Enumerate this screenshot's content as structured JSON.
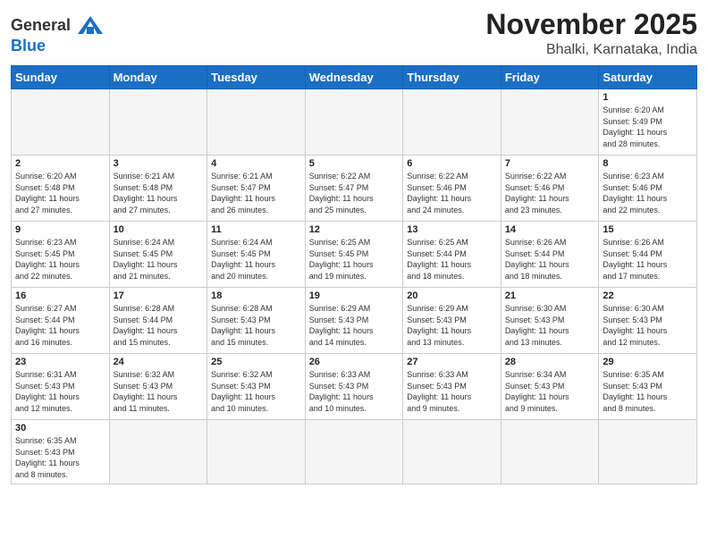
{
  "header": {
    "logo_general": "General",
    "logo_blue": "Blue",
    "month_title": "November 2025",
    "location": "Bhalki, Karnataka, India"
  },
  "weekdays": [
    "Sunday",
    "Monday",
    "Tuesday",
    "Wednesday",
    "Thursday",
    "Friday",
    "Saturday"
  ],
  "weeks": [
    [
      {
        "day": "",
        "info": ""
      },
      {
        "day": "",
        "info": ""
      },
      {
        "day": "",
        "info": ""
      },
      {
        "day": "",
        "info": ""
      },
      {
        "day": "",
        "info": ""
      },
      {
        "day": "",
        "info": ""
      },
      {
        "day": "1",
        "info": "Sunrise: 6:20 AM\nSunset: 5:49 PM\nDaylight: 11 hours\nand 28 minutes."
      }
    ],
    [
      {
        "day": "2",
        "info": "Sunrise: 6:20 AM\nSunset: 5:48 PM\nDaylight: 11 hours\nand 27 minutes."
      },
      {
        "day": "3",
        "info": "Sunrise: 6:21 AM\nSunset: 5:48 PM\nDaylight: 11 hours\nand 27 minutes."
      },
      {
        "day": "4",
        "info": "Sunrise: 6:21 AM\nSunset: 5:47 PM\nDaylight: 11 hours\nand 26 minutes."
      },
      {
        "day": "5",
        "info": "Sunrise: 6:22 AM\nSunset: 5:47 PM\nDaylight: 11 hours\nand 25 minutes."
      },
      {
        "day": "6",
        "info": "Sunrise: 6:22 AM\nSunset: 5:46 PM\nDaylight: 11 hours\nand 24 minutes."
      },
      {
        "day": "7",
        "info": "Sunrise: 6:22 AM\nSunset: 5:46 PM\nDaylight: 11 hours\nand 23 minutes."
      },
      {
        "day": "8",
        "info": "Sunrise: 6:23 AM\nSunset: 5:46 PM\nDaylight: 11 hours\nand 22 minutes."
      }
    ],
    [
      {
        "day": "9",
        "info": "Sunrise: 6:23 AM\nSunset: 5:45 PM\nDaylight: 11 hours\nand 22 minutes."
      },
      {
        "day": "10",
        "info": "Sunrise: 6:24 AM\nSunset: 5:45 PM\nDaylight: 11 hours\nand 21 minutes."
      },
      {
        "day": "11",
        "info": "Sunrise: 6:24 AM\nSunset: 5:45 PM\nDaylight: 11 hours\nand 20 minutes."
      },
      {
        "day": "12",
        "info": "Sunrise: 6:25 AM\nSunset: 5:45 PM\nDaylight: 11 hours\nand 19 minutes."
      },
      {
        "day": "13",
        "info": "Sunrise: 6:25 AM\nSunset: 5:44 PM\nDaylight: 11 hours\nand 18 minutes."
      },
      {
        "day": "14",
        "info": "Sunrise: 6:26 AM\nSunset: 5:44 PM\nDaylight: 11 hours\nand 18 minutes."
      },
      {
        "day": "15",
        "info": "Sunrise: 6:26 AM\nSunset: 5:44 PM\nDaylight: 11 hours\nand 17 minutes."
      }
    ],
    [
      {
        "day": "16",
        "info": "Sunrise: 6:27 AM\nSunset: 5:44 PM\nDaylight: 11 hours\nand 16 minutes."
      },
      {
        "day": "17",
        "info": "Sunrise: 6:28 AM\nSunset: 5:44 PM\nDaylight: 11 hours\nand 15 minutes."
      },
      {
        "day": "18",
        "info": "Sunrise: 6:28 AM\nSunset: 5:43 PM\nDaylight: 11 hours\nand 15 minutes."
      },
      {
        "day": "19",
        "info": "Sunrise: 6:29 AM\nSunset: 5:43 PM\nDaylight: 11 hours\nand 14 minutes."
      },
      {
        "day": "20",
        "info": "Sunrise: 6:29 AM\nSunset: 5:43 PM\nDaylight: 11 hours\nand 13 minutes."
      },
      {
        "day": "21",
        "info": "Sunrise: 6:30 AM\nSunset: 5:43 PM\nDaylight: 11 hours\nand 13 minutes."
      },
      {
        "day": "22",
        "info": "Sunrise: 6:30 AM\nSunset: 5:43 PM\nDaylight: 11 hours\nand 12 minutes."
      }
    ],
    [
      {
        "day": "23",
        "info": "Sunrise: 6:31 AM\nSunset: 5:43 PM\nDaylight: 11 hours\nand 12 minutes."
      },
      {
        "day": "24",
        "info": "Sunrise: 6:32 AM\nSunset: 5:43 PM\nDaylight: 11 hours\nand 11 minutes."
      },
      {
        "day": "25",
        "info": "Sunrise: 6:32 AM\nSunset: 5:43 PM\nDaylight: 11 hours\nand 10 minutes."
      },
      {
        "day": "26",
        "info": "Sunrise: 6:33 AM\nSunset: 5:43 PM\nDaylight: 11 hours\nand 10 minutes."
      },
      {
        "day": "27",
        "info": "Sunrise: 6:33 AM\nSunset: 5:43 PM\nDaylight: 11 hours\nand 9 minutes."
      },
      {
        "day": "28",
        "info": "Sunrise: 6:34 AM\nSunset: 5:43 PM\nDaylight: 11 hours\nand 9 minutes."
      },
      {
        "day": "29",
        "info": "Sunrise: 6:35 AM\nSunset: 5:43 PM\nDaylight: 11 hours\nand 8 minutes."
      }
    ],
    [
      {
        "day": "30",
        "info": "Sunrise: 6:35 AM\nSunset: 5:43 PM\nDaylight: 11 hours\nand 8 minutes."
      },
      {
        "day": "",
        "info": ""
      },
      {
        "day": "",
        "info": ""
      },
      {
        "day": "",
        "info": ""
      },
      {
        "day": "",
        "info": ""
      },
      {
        "day": "",
        "info": ""
      },
      {
        "day": "",
        "info": ""
      }
    ]
  ]
}
